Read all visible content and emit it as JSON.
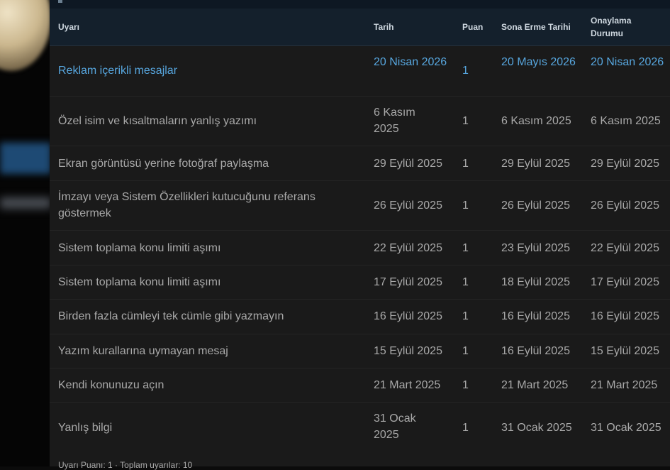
{
  "table": {
    "headers": {
      "warning": "Uyarı",
      "date": "Tarih",
      "points": "Puan",
      "expiry": "Sona Erme Tarihi",
      "approval_line1": "Onaylama",
      "approval_line2": "Durumu"
    },
    "rows": [
      {
        "title": "Reklam içerikli mesajlar",
        "date": "20 Nisan 2026",
        "points": "1",
        "expiry": "20 Mayıs 2026",
        "approval": "20 Nisan 2026",
        "highlight": true
      },
      {
        "title": "Özel isim ve kısaltmaların yanlış yazımı",
        "date": "6 Kasım 2025",
        "points": "1",
        "expiry": "6 Kasım 2025",
        "approval": "6 Kasım 2025"
      },
      {
        "title": "Ekran görüntüsü yerine fotoğraf paylaşma",
        "date": "29 Eylül 2025",
        "points": "1",
        "expiry": "29 Eylül 2025",
        "approval": "29 Eylül 2025"
      },
      {
        "title": "İmzayı veya Sistem Özellikleri kutucuğunu referans göstermek",
        "date": "26 Eylül 2025",
        "points": "1",
        "expiry": "26 Eylül 2025",
        "approval": "26 Eylül 2025"
      },
      {
        "title": "Sistem toplama konu limiti aşımı",
        "date": "22 Eylül 2025",
        "points": "1",
        "expiry": "23 Eylül 2025",
        "approval": "22 Eylül 2025"
      },
      {
        "title": "Sistem toplama konu limiti aşımı",
        "date": "17 Eylül 2025",
        "points": "1",
        "expiry": "18 Eylül 2025",
        "approval": "17 Eylül 2025"
      },
      {
        "title": "Birden fazla cümleyi tek cümle gibi yazmayın",
        "date": "16 Eylül 2025",
        "points": "1",
        "expiry": "16 Eylül 2025",
        "approval": "16 Eylül 2025"
      },
      {
        "title": "Yazım kurallarına uymayan mesaj",
        "date": "15 Eylül 2025",
        "points": "1",
        "expiry": "16 Eylül 2025",
        "approval": "15 Eylül 2025"
      },
      {
        "title": "Kendi konunuzu açın",
        "date": "21 Mart 2025",
        "points": "1",
        "expiry": "21 Mart 2025",
        "approval": "21 Mart 2025"
      },
      {
        "title": "Yanlış bilgi",
        "date": "31 Ocak 2025",
        "points": "1",
        "expiry": "31 Ocak 2025",
        "approval": "31 Ocak 2025"
      }
    ]
  },
  "footer": {
    "summary": "Uyarı Puanı: 1 · Toplam uyarılar: 10"
  },
  "colors": {
    "link": "#57a6de",
    "text": "#a9a9a9",
    "header_bg": "#14202c",
    "row_bg": "#1a1a1a"
  }
}
